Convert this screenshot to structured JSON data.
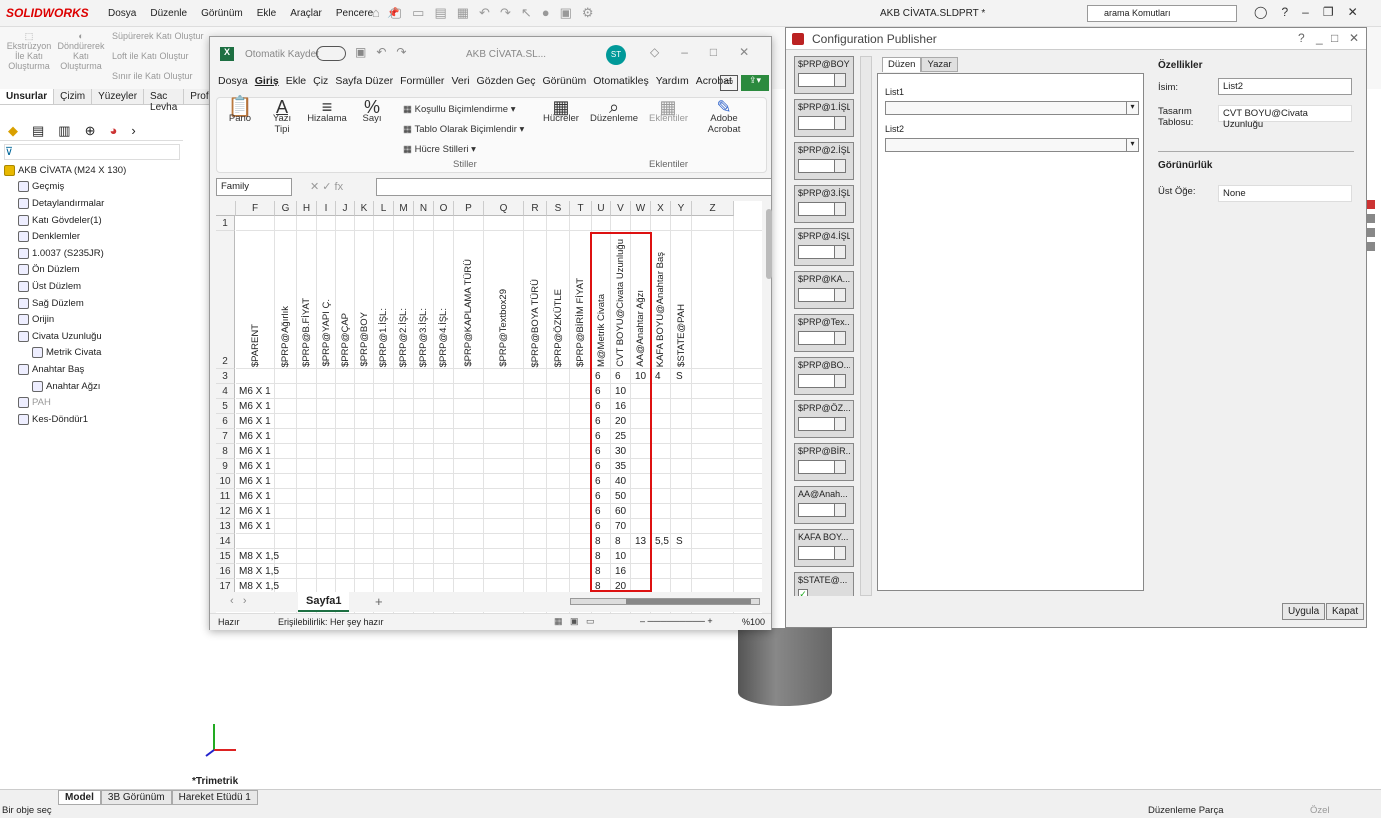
{
  "sw": {
    "logo": "SOLIDWORKS",
    "menu": [
      "Dosya",
      "Düzenle",
      "Görünüm",
      "Ekle",
      "Araçlar",
      "Pencere"
    ],
    "title": "AKB CİVATA.SLDPRT *",
    "search_placeholder": "arama Komutları",
    "commands": {
      "extrude": "Ekstrüzyon İle Katı Oluşturma",
      "revolve": "Döndürerek Katı Oluşturma",
      "sweep": "Süpürerek Katı Oluştur",
      "loft": "Loft ile Katı Oluştur",
      "boundary": "Sınır ile Katı Oluştur"
    },
    "tabs": [
      "Unsurlar",
      "Çizim",
      "Yüzeyler",
      "Sac Levha",
      "Prof"
    ],
    "tree": [
      {
        "label": "AKB CİVATA (M24 X 130)",
        "indent": 0
      },
      {
        "label": "Geçmiş",
        "indent": 1
      },
      {
        "label": "Detaylandırmalar",
        "indent": 1
      },
      {
        "label": "Katı Gövdeler(1)",
        "indent": 1
      },
      {
        "label": "Denklemler",
        "indent": 1
      },
      {
        "label": "1.0037 (S235JR)",
        "indent": 1
      },
      {
        "label": "Ön Düzlem",
        "indent": 1
      },
      {
        "label": "Üst Düzlem",
        "indent": 1
      },
      {
        "label": "Sağ Düzlem",
        "indent": 1
      },
      {
        "label": "Orijin",
        "indent": 1
      },
      {
        "label": "Civata Uzunluğu",
        "indent": 1
      },
      {
        "label": "Metrik Civata",
        "indent": 2
      },
      {
        "label": "Anahtar Baş",
        "indent": 1
      },
      {
        "label": "Anahtar Ağzı",
        "indent": 2
      },
      {
        "label": "PAH",
        "indent": 1
      },
      {
        "label": "Kes-Döndür1",
        "indent": 1
      }
    ],
    "view_label": "*Trimetrik",
    "bottom_tabs": [
      "Model",
      "3B Görünüm",
      "Hareket Etüdü 1"
    ],
    "status_left": "Bir obje seç",
    "status_right": "Düzenleme Parça",
    "status_custom": "Özel"
  },
  "excel": {
    "autosave": "Otomatik Kaydet",
    "filename": "AKB CİVATA.SL...",
    "avatar": "ST",
    "menu": [
      "Dosya",
      "Giriş",
      "Ekle",
      "Çiz",
      "Sayfa Düzer",
      "Formüller",
      "Veri",
      "Gözden Geç",
      "Görünüm",
      "Otomatikleş",
      "Yardım",
      "Acrobat"
    ],
    "ribbon": {
      "pano": "Pano",
      "yazi": "Yazı Tipi",
      "hizalama": "Hizalama",
      "sayi": "Sayı",
      "kosullu": "Koşullu Biçimlendirme",
      "tablo": "Tablo Olarak Biçimlendir",
      "hucre_stilleri": "Hücre Stilleri",
      "stiller": "Stiller",
      "hucreler": "Hücreler",
      "duzenleme": "Düzenleme",
      "eklentiler": "Eklentiler",
      "eklentiler_grp": "Eklentiler",
      "acrobat": "Adobe Acrobat"
    },
    "namebox": "Family",
    "columns": [
      "F",
      "G",
      "H",
      "I",
      "J",
      "K",
      "L",
      "M",
      "N",
      "O",
      "P",
      "Q",
      "R",
      "S",
      "T",
      "U",
      "V",
      "W",
      "X",
      "Y",
      "Z"
    ],
    "headers": [
      "$PARENT",
      "$PRP@Ağırlık",
      "$PRP@B.FİYAT",
      "$PRP@YAPI Ç.",
      "$PRP@ÇAP",
      "$PRP@BOY",
      "$PRP@1.İŞL:",
      "$PRP@2.İŞL:",
      "$PRP@3.İŞL:",
      "$PRP@4.İŞL:",
      "$PRP@KAPLAMA TÜRÜ",
      "$PRP@Textbox29",
      "$PRP@BOYA TÜRÜ",
      "$PRP@ÖZKÜTLE",
      "$PRP@BİRİM FİYAT",
      "M@Metrik Civata",
      "CVT BOYU@Civata Uzunluğu",
      "AA@Anahtar Ağzı",
      "KAFA BOYU@Anahtar Baş",
      "$STATE@PAH"
    ],
    "rows": [
      {
        "n": "1",
        "F": "",
        "U": "",
        "V": "",
        "W": "",
        "X": "",
        "Y": ""
      },
      {
        "n": "2",
        "F": "",
        "U": "",
        "V": "",
        "W": "",
        "X": "",
        "Y": ""
      },
      {
        "n": "3",
        "F": "",
        "U": "6",
        "V": "6",
        "W": "10",
        "X": "4",
        "Y": "S"
      },
      {
        "n": "4",
        "F": "M6 X 1",
        "U": "6",
        "V": "10",
        "W": "",
        "X": "",
        "Y": ""
      },
      {
        "n": "5",
        "F": "M6 X 1",
        "U": "6",
        "V": "16",
        "W": "",
        "X": "",
        "Y": ""
      },
      {
        "n": "6",
        "F": "M6 X 1",
        "U": "6",
        "V": "20",
        "W": "",
        "X": "",
        "Y": ""
      },
      {
        "n": "7",
        "F": "M6 X 1",
        "U": "6",
        "V": "25",
        "W": "",
        "X": "",
        "Y": ""
      },
      {
        "n": "8",
        "F": "M6 X 1",
        "U": "6",
        "V": "30",
        "W": "",
        "X": "",
        "Y": ""
      },
      {
        "n": "9",
        "F": "M6 X 1",
        "U": "6",
        "V": "35",
        "W": "",
        "X": "",
        "Y": ""
      },
      {
        "n": "10",
        "F": "M6 X 1",
        "U": "6",
        "V": "40",
        "W": "",
        "X": "",
        "Y": ""
      },
      {
        "n": "11",
        "F": "M6 X 1",
        "U": "6",
        "V": "50",
        "W": "",
        "X": "",
        "Y": ""
      },
      {
        "n": "12",
        "F": "M6 X 1",
        "U": "6",
        "V": "60",
        "W": "",
        "X": "",
        "Y": ""
      },
      {
        "n": "13",
        "F": "M6 X 1",
        "U": "6",
        "V": "70",
        "W": "",
        "X": "",
        "Y": ""
      },
      {
        "n": "14",
        "F": "",
        "U": "8",
        "V": "8",
        "W": "13",
        "X": "5,5",
        "Y": "S"
      },
      {
        "n": "15",
        "F": "M8 X 1,5",
        "U": "8",
        "V": "10",
        "W": "",
        "X": "",
        "Y": ""
      },
      {
        "n": "16",
        "F": "M8 X 1,5",
        "U": "8",
        "V": "16",
        "W": "",
        "X": "",
        "Y": ""
      },
      {
        "n": "17",
        "F": "M8 X 1,5",
        "U": "8",
        "V": "20",
        "W": "",
        "X": "",
        "Y": ""
      }
    ],
    "sheet": "Sayfa1",
    "status_ready": "Hazır",
    "status_access": "Erişilebilirlik: Her şey hazır",
    "zoom": "%100"
  },
  "cp": {
    "title": "Configuration Publisher",
    "title_help": "?",
    "params": [
      "$PRP@BOY",
      "$PRP@1.İŞL:",
      "$PRP@2.İŞL:",
      "$PRP@3.İŞL:",
      "$PRP@4.İŞL:",
      "$PRP@KA...",
      "$PRP@Tex...",
      "$PRP@BO...",
      "$PRP@ÖZ...",
      "$PRP@BİR...",
      "AA@Anah...",
      "KAFA BOY...",
      "$STATE@..."
    ],
    "tabs": [
      "Düzen",
      "Yazar"
    ],
    "list1": "List1",
    "list2": "List2",
    "props_title": "Özellikler",
    "name_label": "İsim:",
    "name_value": "List2",
    "design_label": "Tasarım Tablosu:",
    "design_value": "CVT BOYU@Civata Uzunluğu",
    "vis_title": "Görünürlük",
    "parent_label": "Üst Öğe:",
    "parent_value": "None",
    "apply": "Uygula",
    "close": "Kapat"
  }
}
